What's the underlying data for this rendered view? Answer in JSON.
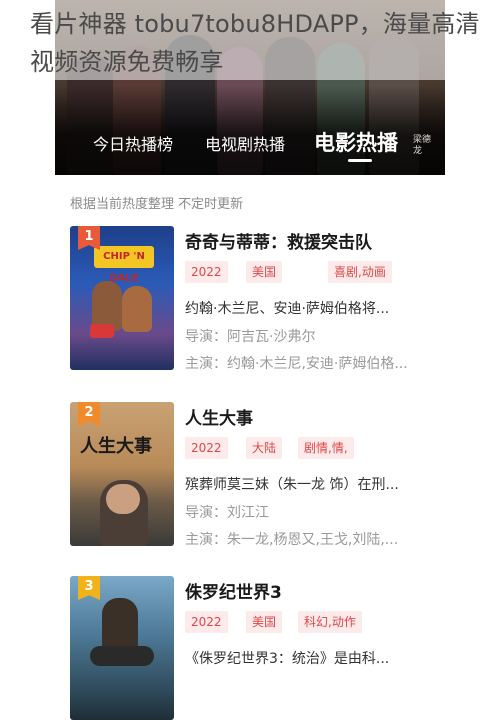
{
  "caption": "看片神器 tobu7tobu8HDAPP，海量高清视频资源免费畅享",
  "hero": {
    "tabs": [
      "今日热播榜",
      "电视剧热播",
      "电影热播"
    ],
    "active_tab": "电影热播",
    "credit": "梁德龙"
  },
  "subtitle": "根据当前热度整理 不定时更新",
  "colors": {
    "tag_bg": "#fdeaea",
    "tag_text": "#e04848",
    "rank1": "#e85a3a",
    "rank2": "#f08a2a",
    "rank3": "#f2b21c"
  },
  "items": [
    {
      "rank": "1",
      "title": "奇奇与蒂蒂：救援突击队",
      "tags": [
        "2022",
        "美国",
        "喜剧,动画"
      ],
      "desc": "约翰·木兰尼、安迪·萨姆伯格将...",
      "director": "导演：阿吉瓦·沙弗尔",
      "cast": "主演：约翰·木兰尼,安迪·萨姆伯格...",
      "poster_text": "CHIP 'N DALE"
    },
    {
      "rank": "2",
      "title": "人生大事",
      "tags": [
        "2022",
        "大陆",
        "剧情,情,"
      ],
      "desc": "殡葬师莫三妹（朱一龙 饰）在刑...",
      "director": "导演：刘江江",
      "cast": "主演：朱一龙,杨恩又,王戈,刘陆,...",
      "poster_text": "人生大事"
    },
    {
      "rank": "3",
      "title": "侏罗纪世界3",
      "tags": [
        "2022",
        "美国",
        "科幻,动作"
      ],
      "desc": "《侏罗纪世界3：统治》是由科...",
      "director": "",
      "cast": "",
      "poster_text": ""
    }
  ]
}
